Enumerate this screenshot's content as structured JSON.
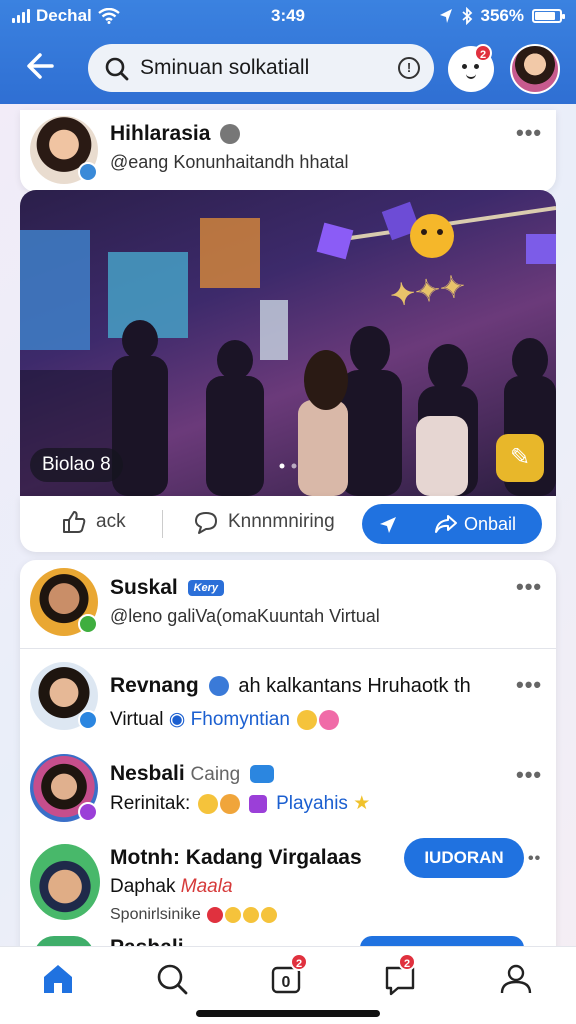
{
  "status_bar": {
    "carrier": "Dechal",
    "time": "3:49",
    "battery": "356%"
  },
  "search": {
    "value": "Sminuan solkatiall"
  },
  "top_badge": "2",
  "post": {
    "name": "Hihlarasia",
    "handle": "@eang Konunhaitandh hhatal",
    "caption": "Biolao 8",
    "actions": {
      "back": "ack",
      "comment": "Knnnmniring",
      "share": "Onbail"
    }
  },
  "people": [
    {
      "name": "Suskal",
      "verified": "Kery",
      "line2": "@leno galiVa(omaKuuntah Virtual"
    },
    {
      "name": "Revnang",
      "name_extra": "ah kalkantans Hruhaotk th",
      "line2_prefix": "Virtual",
      "line2_tag": "Fhomyntian"
    },
    {
      "name": "Nesbali",
      "name_extra": "Caing",
      "line2_prefix": "Rerinitak:",
      "line2_tag": "Playahis"
    },
    {
      "name": "Motnh: Kadang Virgalaas",
      "line2_prefix": "Daphak",
      "line2_tag": "Maala",
      "line3": "Sponirlsinike",
      "button": "IUDORAN"
    },
    {
      "name": "Pashali"
    }
  ],
  "nav_badges": {
    "notifications": "2",
    "messages": "2"
  },
  "colors": {
    "app_bar": "#2f6fd3",
    "accent": "#2072e0",
    "badge": "#e0313e",
    "gold": "#e8b72a"
  },
  "icons": {
    "back": "arrow-left-icon",
    "search": "search-icon",
    "info": "info-icon",
    "home": "home-icon",
    "explore": "search-icon",
    "notifications": "bell-icon",
    "messages": "chat-icon",
    "profile": "person-icon"
  }
}
